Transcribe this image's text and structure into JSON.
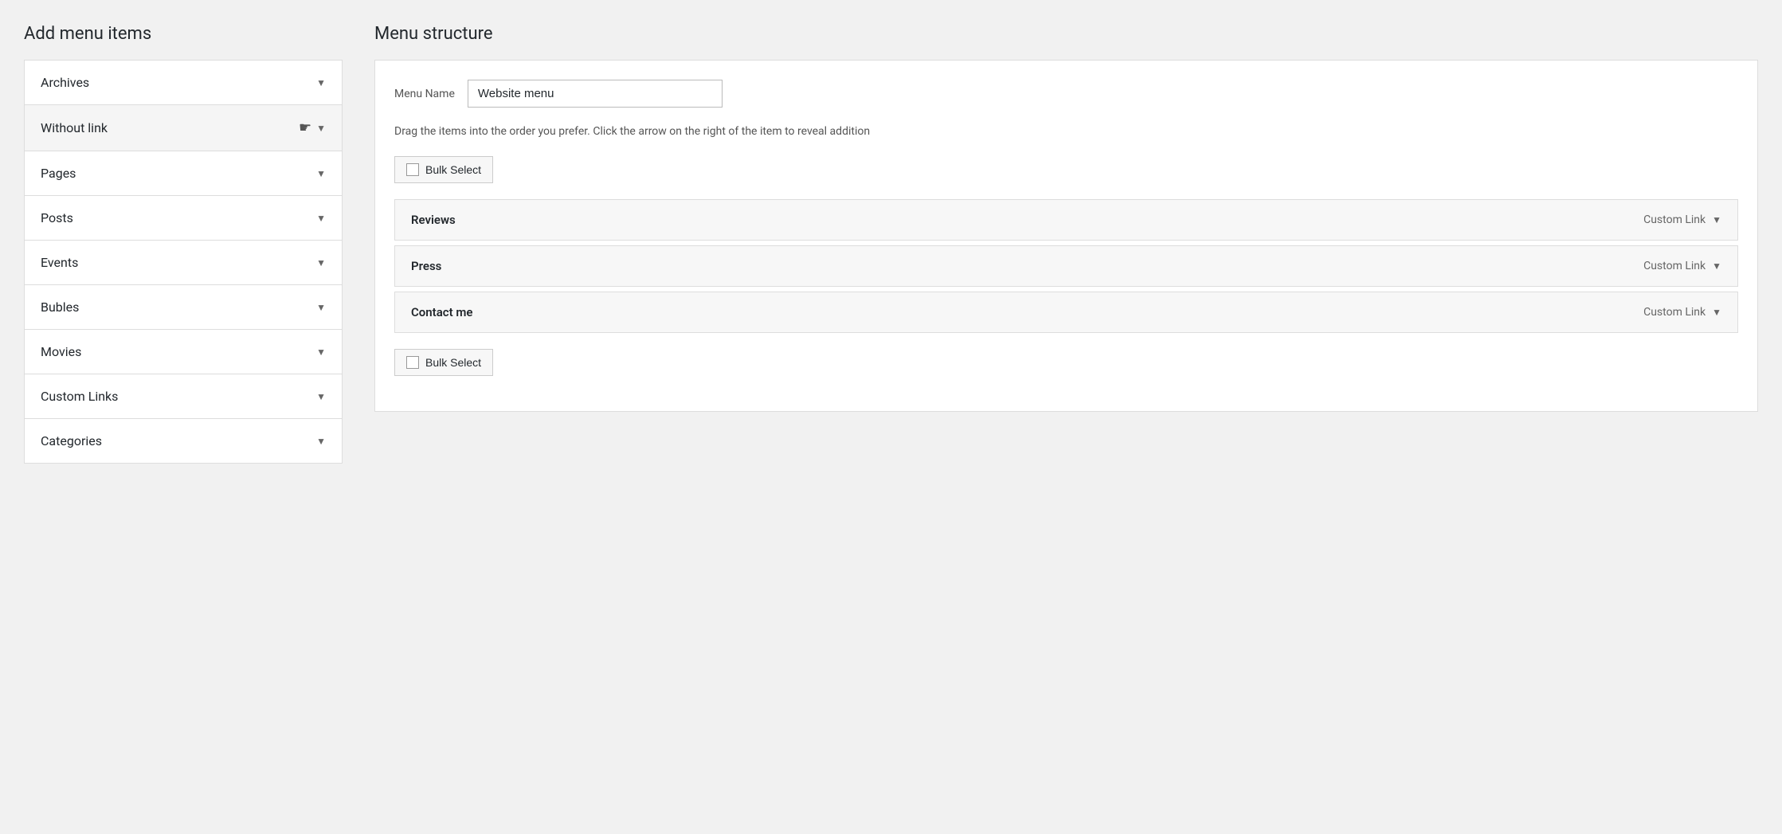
{
  "left_panel": {
    "title": "Add menu items",
    "accordion_items": [
      {
        "id": "archives",
        "label": "Archives"
      },
      {
        "id": "without-link",
        "label": "Without link",
        "hovered": true
      },
      {
        "id": "pages",
        "label": "Pages"
      },
      {
        "id": "posts",
        "label": "Posts"
      },
      {
        "id": "events",
        "label": "Events"
      },
      {
        "id": "bubles",
        "label": "Bubles"
      },
      {
        "id": "movies",
        "label": "Movies"
      },
      {
        "id": "custom-links",
        "label": "Custom Links"
      },
      {
        "id": "categories",
        "label": "Categories"
      }
    ]
  },
  "right_panel": {
    "title": "Menu structure",
    "menu_name_label": "Menu Name",
    "menu_name_value": "Website menu",
    "drag_instruction": "Drag the items into the order you prefer. Click the arrow on the right of the item to reveal addition",
    "bulk_select_label": "Bulk Select",
    "menu_items": [
      {
        "id": "reviews",
        "name": "Reviews",
        "type": "Custom Link"
      },
      {
        "id": "press",
        "name": "Press",
        "type": "Custom Link"
      },
      {
        "id": "contact-me",
        "name": "Contact me",
        "type": "Custom Link"
      }
    ],
    "bulk_select_bottom_label": "Bulk Select"
  },
  "icons": {
    "chevron_down": "▼",
    "cursor": "☛"
  }
}
